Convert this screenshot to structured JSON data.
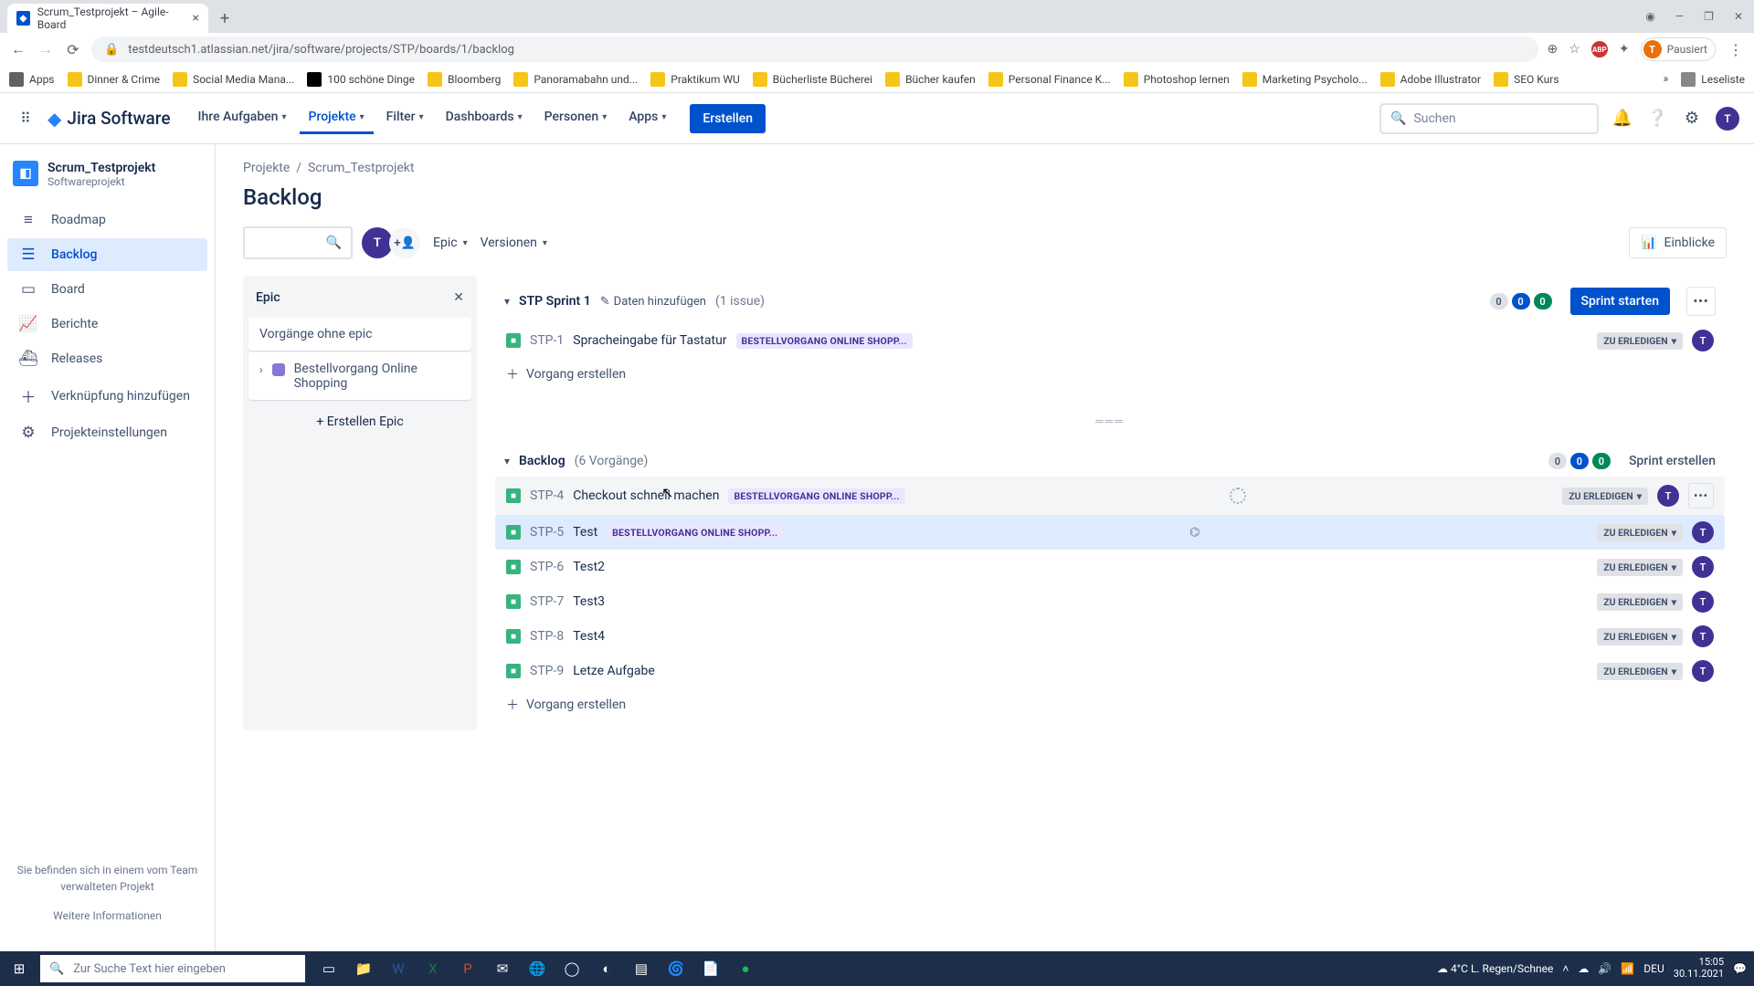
{
  "browser": {
    "tab_title": "Scrum_Testprojekt – Agile-Board",
    "url": "testdeutsch1.atlassian.net/jira/software/projects/STP/boards/1/backlog",
    "profile": "Pausiert",
    "bookmarks": [
      "Apps",
      "Dinner & Crime",
      "Social Media Mana...",
      "100 schöne Dinge",
      "Bloomberg",
      "Panoramabahn und...",
      "Praktikum WU",
      "Bücherliste Bücherei",
      "Bücher kaufen",
      "Personal Finance K...",
      "Photoshop lernen",
      "Marketing Psycholo...",
      "Adobe Illustrator",
      "SEO Kurs"
    ],
    "bm_right": "Leseliste",
    "win": {
      "min": "—",
      "max": "❐",
      "close": "✕"
    }
  },
  "jira_nav": {
    "product": "Jira Software",
    "items": [
      "Ihre Aufgaben",
      "Projekte",
      "Filter",
      "Dashboards",
      "Personen",
      "Apps"
    ],
    "create": "Erstellen",
    "search_placeholder": "Suchen"
  },
  "sidebar": {
    "project_name": "Scrum_Testprojekt",
    "project_type": "Softwareprojekt",
    "items": [
      {
        "icon": "≡",
        "label": "Roadmap"
      },
      {
        "icon": "☰",
        "label": "Backlog"
      },
      {
        "icon": "▭",
        "label": "Board"
      },
      {
        "icon": "📈",
        "label": "Berichte"
      },
      {
        "icon": "⛴",
        "label": "Releases"
      },
      {
        "icon": "＋",
        "label": "Verknüpfung hinzufügen"
      },
      {
        "icon": "⚙",
        "label": "Projekteinstellungen"
      }
    ],
    "footer1": "Sie befinden sich in einem vom Team verwalteten Projekt",
    "footer2": "Weitere Informationen"
  },
  "page": {
    "crumb1": "Projekte",
    "crumb2": "Scrum_Testprojekt",
    "title": "Backlog",
    "epic_label": "Epic",
    "versionen": "Versionen",
    "insights": "Einblicke"
  },
  "epic_panel": {
    "header": "Epic",
    "no_epic": "Vorgänge ohne epic",
    "epic1": "Bestellvorgang Online Shopping",
    "create": "Erstellen Epic"
  },
  "sprint": {
    "name": "STP Sprint 1",
    "add_dates": "Daten hinzufügen",
    "count": "(1 issue)",
    "pills": [
      "0",
      "0",
      "0"
    ],
    "start": "Sprint starten",
    "create_issue": "Vorgang erstellen",
    "issues": [
      {
        "key": "STP-1",
        "sum": "Spracheingabe für Tastatur",
        "epic": "BESTELLVORGANG ONLINE SHOPP...",
        "status": "ZU ERLEDIGEN"
      }
    ]
  },
  "backlog": {
    "name": "Backlog",
    "count": "(6 Vorgänge)",
    "pills": [
      "0",
      "0",
      "0"
    ],
    "create_sprint": "Sprint erstellen",
    "create_issue": "Vorgang erstellen",
    "issues": [
      {
        "key": "STP-4",
        "sum": "Checkout schnell machen",
        "epic": "BESTELLVORGANG ONLINE SHOPP...",
        "status": "ZU ERLEDIGEN",
        "hover": true,
        "show_more": true,
        "show_dash": true
      },
      {
        "key": "STP-5",
        "sum": "Test",
        "epic": "BESTELLVORGANG ONLINE SHOPP...",
        "status": "ZU ERLEDIGEN",
        "selected": true,
        "tree": true
      },
      {
        "key": "STP-6",
        "sum": "Test2",
        "status": "ZU ERLEDIGEN"
      },
      {
        "key": "STP-7",
        "sum": "Test3",
        "status": "ZU ERLEDIGEN"
      },
      {
        "key": "STP-8",
        "sum": "Test4",
        "status": "ZU ERLEDIGEN"
      },
      {
        "key": "STP-9",
        "sum": "Letze Aufgabe",
        "status": "ZU ERLEDIGEN"
      }
    ]
  },
  "taskbar": {
    "search": "Zur Suche Text hier eingeben",
    "weather": "4°C  L. Regen/Schnee",
    "lang": "DEU",
    "time": "15:05",
    "date": "30.11.2021"
  }
}
